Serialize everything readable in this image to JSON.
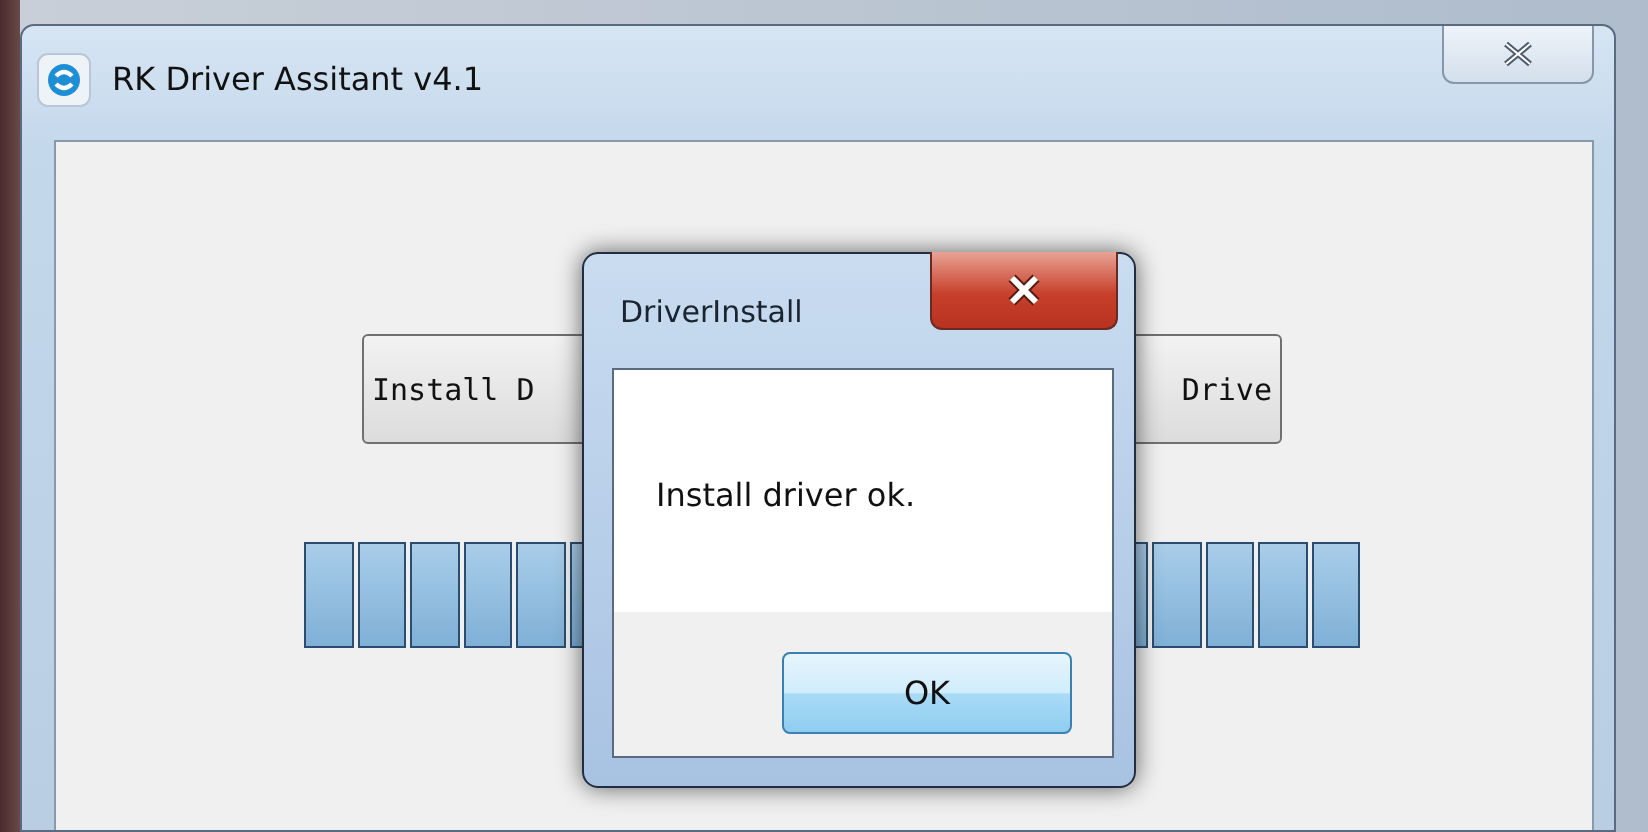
{
  "window": {
    "title": "RK Driver Assitant v4.1"
  },
  "buttons": [
    {
      "label": "Install D"
    },
    {
      "label": "Drive"
    }
  ],
  "progress": {
    "level": 1
  },
  "dialog": {
    "title": "DriverInstall",
    "message": "Install driver ok.",
    "button": "OK"
  }
}
